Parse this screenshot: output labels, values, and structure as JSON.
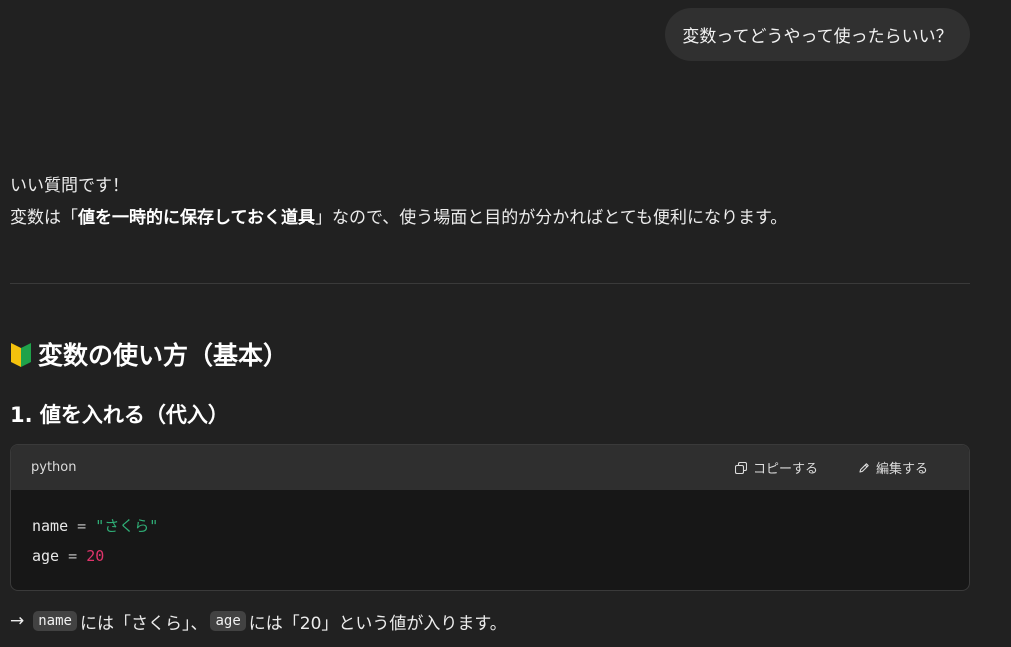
{
  "user_message": "変数ってどうやって使ったらいい？",
  "assistant": {
    "intro_line1": "いい質問です！",
    "intro_line2_prefix": "変数は「",
    "intro_line2_bold": "値を一時的に保存しておく道具",
    "intro_line2_suffix": "」なので、使う場面と目的が分かればとても便利になります。",
    "section_heading": "変数の使い方（基本）",
    "section_icon": "beginner-mark-icon",
    "sub_heading": "1. 値を入れる（代入）",
    "code_block": {
      "language": "python",
      "copy_label": "コピーする",
      "edit_label": "編集する",
      "lines": [
        {
          "name": "name",
          "op": "=",
          "value": "\"さくら\""
        },
        {
          "name": "age",
          "op": "=",
          "value": "20"
        }
      ]
    },
    "after": {
      "arrow": "→",
      "code1": "name",
      "text1": "には「さくら」、",
      "code2": "age",
      "text2": "には「20」という値が入ります。"
    }
  },
  "colors": {
    "background": "#212121",
    "bubble": "#303030",
    "code_string": "#2fae76",
    "code_number": "#e0346b"
  }
}
